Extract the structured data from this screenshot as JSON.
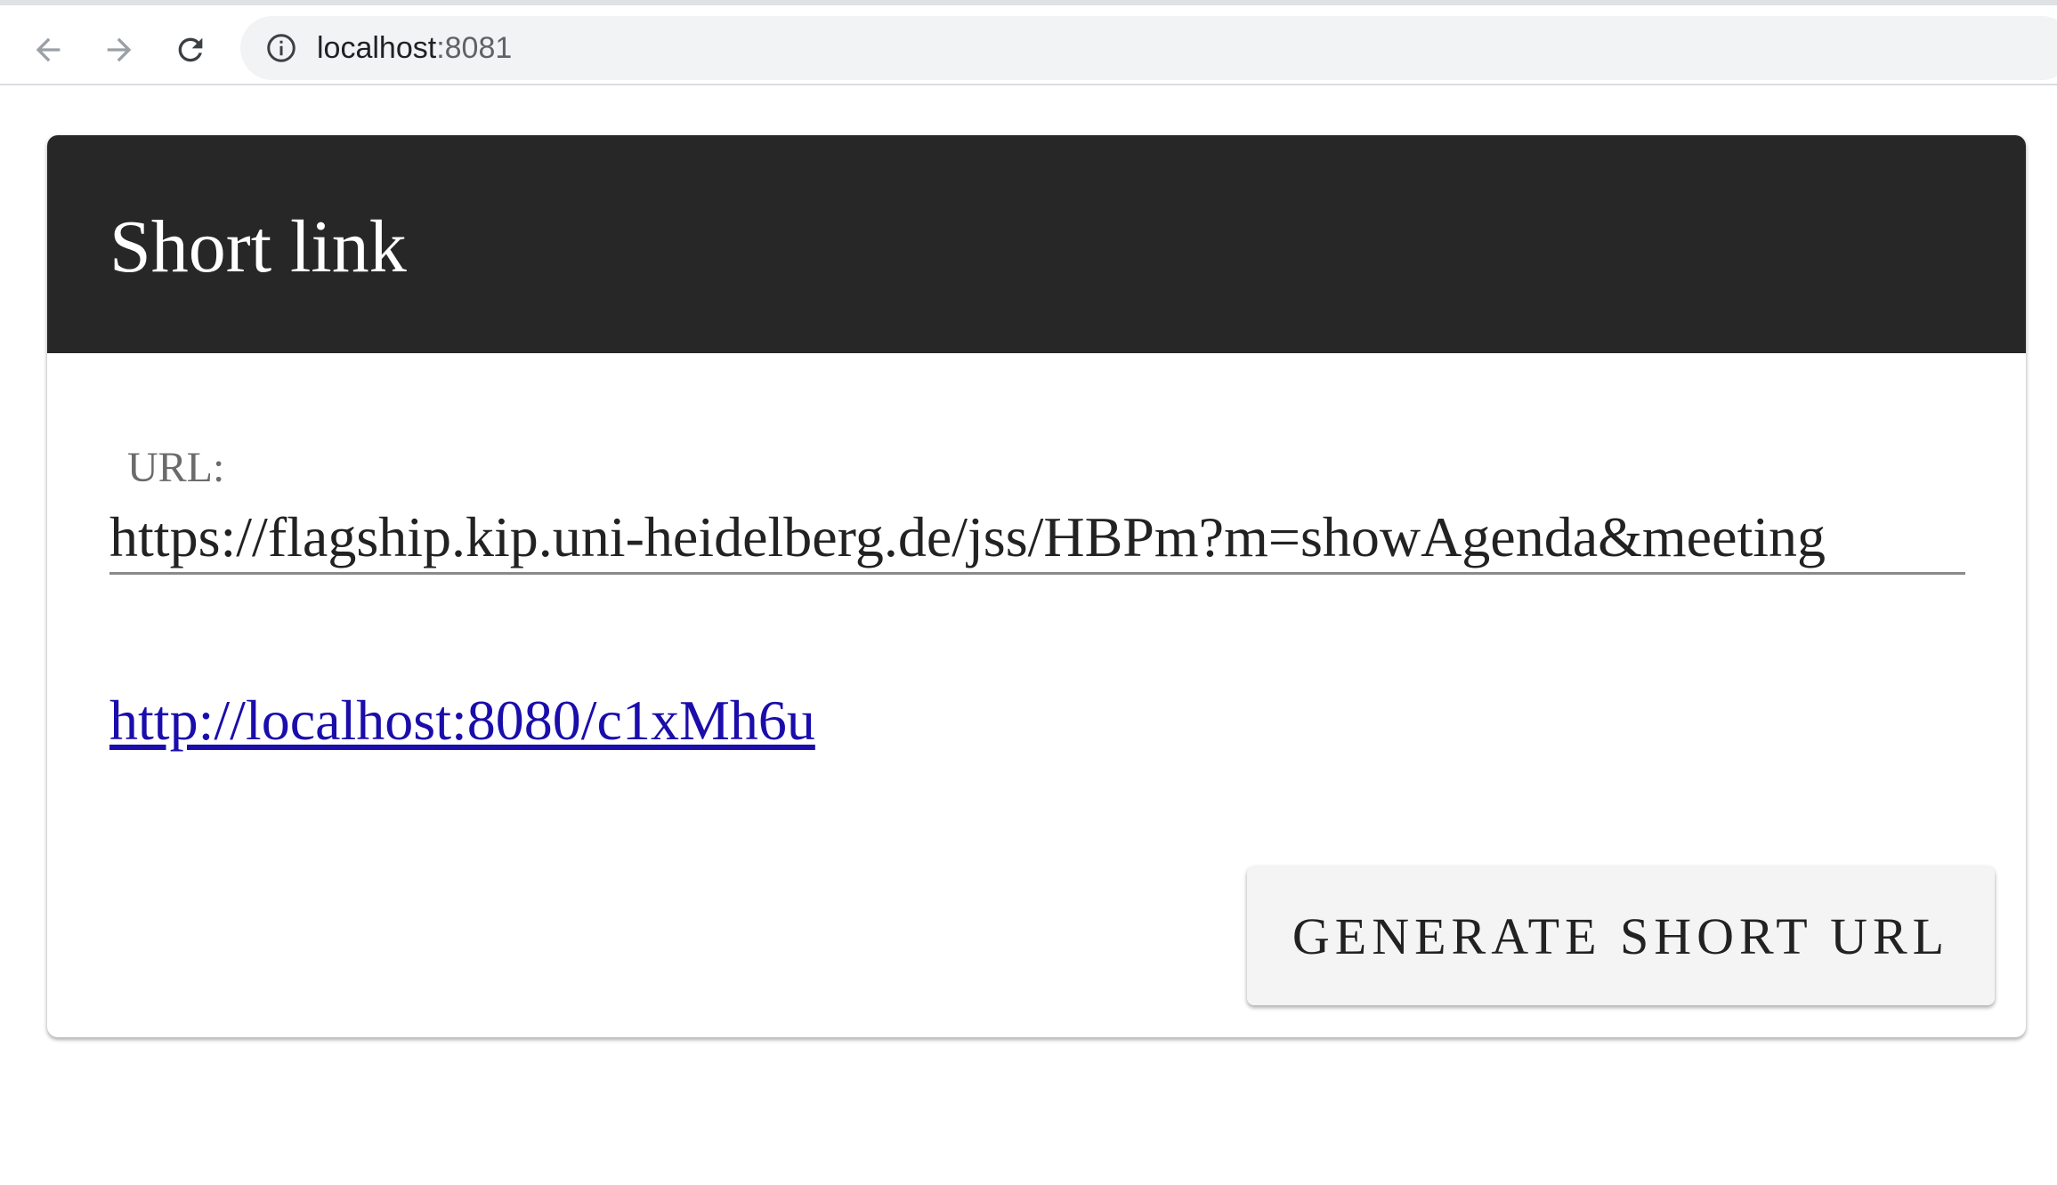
{
  "browser": {
    "address_host": "localhost",
    "address_port": ":8081",
    "back_icon": "arrow-left-icon",
    "forward_icon": "arrow-right-icon",
    "reload_icon": "reload-icon",
    "site_info_icon": "info-icon"
  },
  "card": {
    "title": "Short link",
    "url_label": "URL:",
    "url_value": "https://flagship.kip.uni-heidelberg.de/jss/HBPm?m=showAgenda&meeting",
    "short_link": "http://localhost:8080/c1xMh6u",
    "button_label": "GENERATE SHORT URL"
  },
  "colors": {
    "header_bg": "#272727",
    "link": "#1a0dab",
    "button_bg": "#f4f4f4"
  }
}
